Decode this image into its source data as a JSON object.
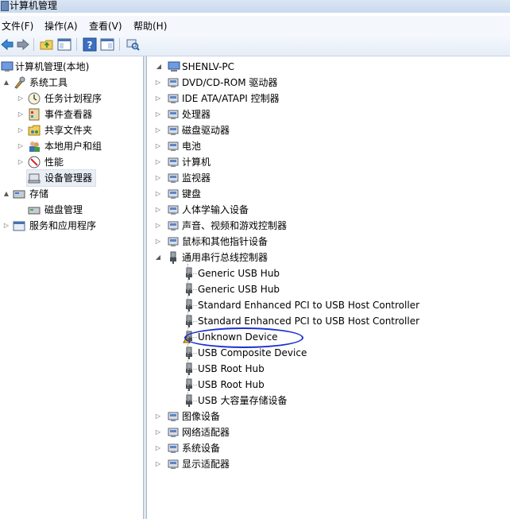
{
  "window": {
    "title": "计算机管理"
  },
  "menu": [
    "文件(F)",
    "操作(A)",
    "查看(V)",
    "帮助(H)"
  ],
  "toolbar": [
    "back-icon",
    "forward-icon",
    "up-folder-icon",
    "show-hide-tree-icon",
    "help-icon",
    "properties-icon",
    "scan-hardware-icon"
  ],
  "left_tree": [
    {
      "label": "计算机管理(本地)",
      "level": 0,
      "expander": "",
      "icon": "computer-management-icon"
    },
    {
      "label": "系统工具",
      "level": 1,
      "expander": "▲",
      "icon": "system-tools-icon"
    },
    {
      "label": "任务计划程序",
      "level": 2,
      "expander": "▷",
      "icon": "task-scheduler-icon"
    },
    {
      "label": "事件查看器",
      "level": 2,
      "expander": "▷",
      "icon": "event-viewer-icon"
    },
    {
      "label": "共享文件夹",
      "level": 2,
      "expander": "▷",
      "icon": "shared-folders-icon"
    },
    {
      "label": "本地用户和组",
      "level": 2,
      "expander": "▷",
      "icon": "local-users-icon"
    },
    {
      "label": "性能",
      "level": 2,
      "expander": "▷",
      "icon": "performance-icon"
    },
    {
      "label": "设备管理器",
      "level": 2,
      "expander": "",
      "icon": "device-manager-icon",
      "selected": true
    },
    {
      "label": "存储",
      "level": 1,
      "expander": "▲",
      "icon": "storage-icon"
    },
    {
      "label": "磁盘管理",
      "level": 2,
      "expander": "",
      "icon": "disk-management-icon"
    },
    {
      "label": "服务和应用程序",
      "level": 1,
      "expander": "▷",
      "icon": "services-apps-icon"
    }
  ],
  "device_tree": {
    "root": "SHENLV-PC",
    "categories": [
      {
        "label": "DVD/CD-ROM 驱动器",
        "icon": "dvd-drive-icon"
      },
      {
        "label": "IDE ATA/ATAPI 控制器",
        "icon": "ide-controller-icon"
      },
      {
        "label": "处理器",
        "icon": "processor-icon"
      },
      {
        "label": "磁盘驱动器",
        "icon": "disk-drive-icon"
      },
      {
        "label": "电池",
        "icon": "battery-icon"
      },
      {
        "label": "计算机",
        "icon": "computer-icon"
      },
      {
        "label": "监视器",
        "icon": "monitor-icon"
      },
      {
        "label": "键盘",
        "icon": "keyboard-icon"
      },
      {
        "label": "人体学输入设备",
        "icon": "hid-icon"
      },
      {
        "label": "声音、视频和游戏控制器",
        "icon": "sound-icon"
      },
      {
        "label": "鼠标和其他指针设备",
        "icon": "mouse-icon"
      },
      {
        "label": "通用串行总线控制器",
        "icon": "usb-icon",
        "expanded": true
      }
    ],
    "usb_children": [
      {
        "label": "Generic USB Hub",
        "warning": false
      },
      {
        "label": "Generic USB Hub",
        "warning": false
      },
      {
        "label": "Standard Enhanced PCI to USB Host Controller",
        "warning": false
      },
      {
        "label": "Standard Enhanced PCI to USB Host Controller",
        "warning": false
      },
      {
        "label": "Unknown Device",
        "warning": true
      },
      {
        "label": "USB Composite Device",
        "warning": false
      },
      {
        "label": "USB Root Hub",
        "warning": false
      },
      {
        "label": "USB Root Hub",
        "warning": false
      },
      {
        "label": "USB 大容量存储设备",
        "warning": false
      }
    ],
    "after_categories": [
      {
        "label": "图像设备",
        "icon": "imaging-icon"
      },
      {
        "label": "网络适配器",
        "icon": "network-icon"
      },
      {
        "label": "系统设备",
        "icon": "system-devices-icon"
      },
      {
        "label": "显示适配器",
        "icon": "display-adapter-icon"
      }
    ]
  },
  "colors": {
    "annotation_circle": "#1a2fd0",
    "warning": "#f2c400"
  }
}
